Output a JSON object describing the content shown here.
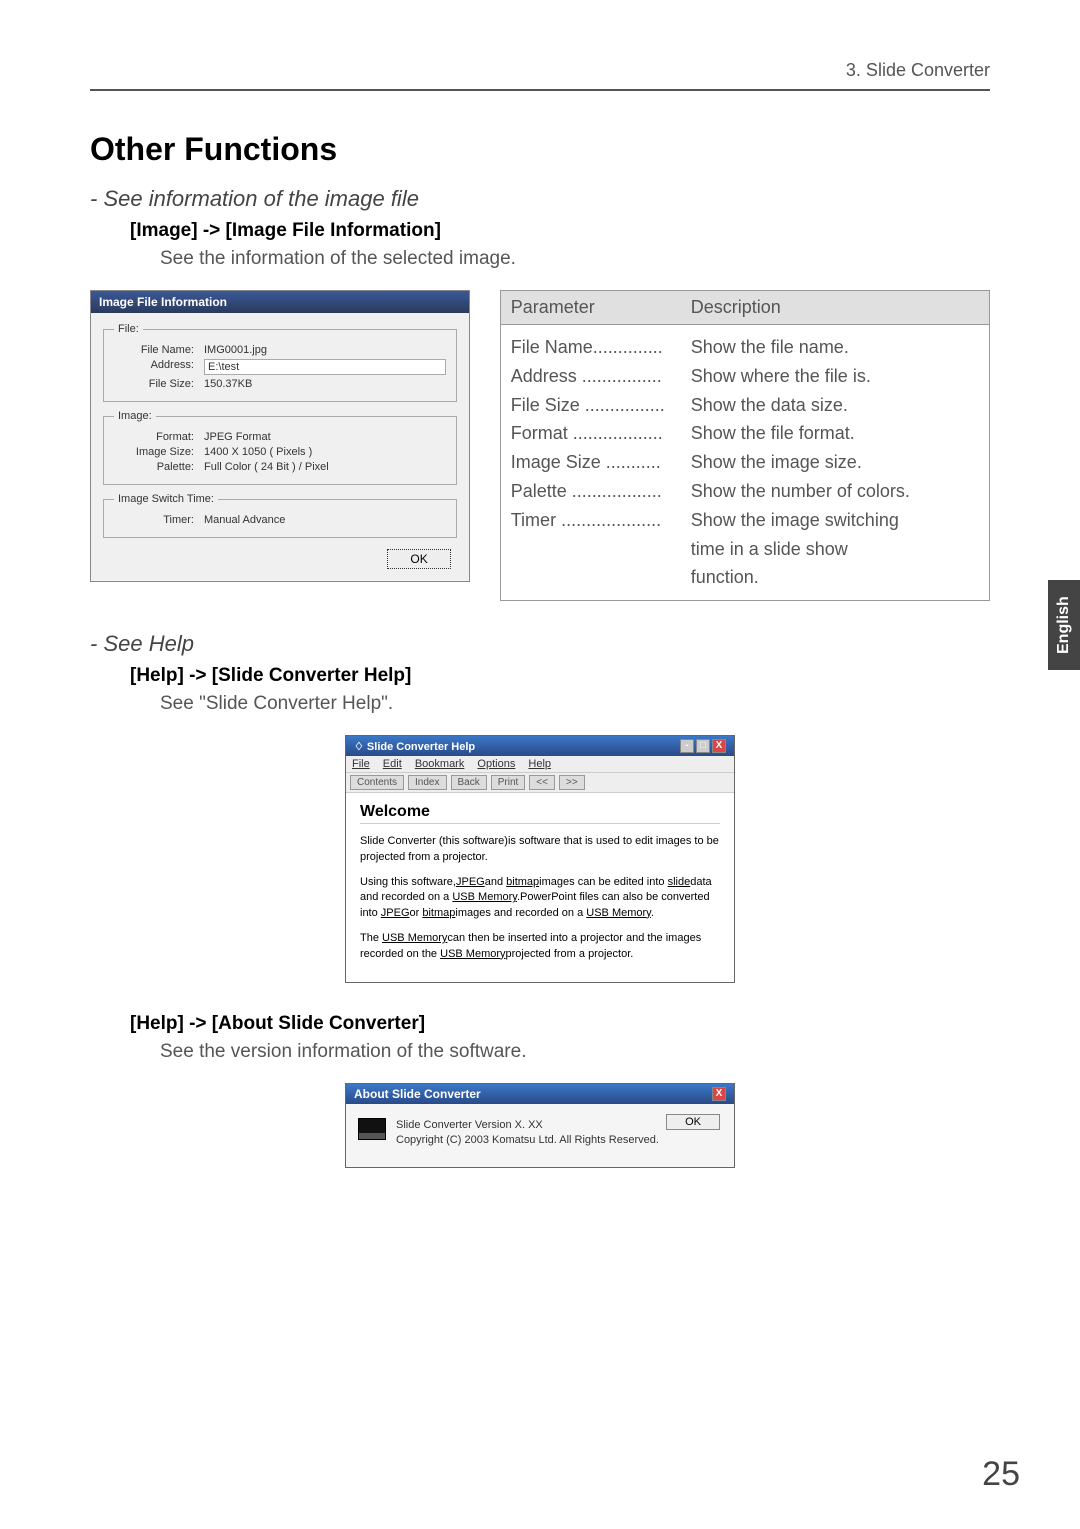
{
  "header": {
    "breadcrumb": "3. Slide Converter"
  },
  "main_heading": "Other Functions",
  "section1": {
    "subtitle": "- See information of the image file",
    "menupath": "[Image] -> [Image File Information]",
    "desc": "See the information of the selected image."
  },
  "dialog": {
    "title": "Image File Information",
    "file_legend": "File:",
    "image_legend": "Image:",
    "timer_legend": "Image Switch Time:",
    "filename_label": "File Name:",
    "filename_value": "IMG0001.jpg",
    "address_label": "Address:",
    "address_value": "E:\\test",
    "filesize_label": "File Size:",
    "filesize_value": "150.37KB",
    "format_label": "Format:",
    "format_value": "JPEG Format",
    "imagesize_label": "Image Size:",
    "imagesize_value": "1400 X 1050 ( Pixels )",
    "palette_label": "Palette:",
    "palette_value": "Full Color ( 24 Bit ) / Pixel",
    "timer_label": "Timer:",
    "timer_value": "Manual Advance",
    "ok": "OK"
  },
  "param_table": {
    "col1": "Parameter",
    "col2": "Description",
    "rows": [
      {
        "name": "File Name",
        "dots": "..............",
        "desc": "Show the file name."
      },
      {
        "name": "Address",
        "dots": " ................",
        "desc": "Show where the file is."
      },
      {
        "name": "File Size",
        "dots": " ................",
        "desc": "Show the data size."
      },
      {
        "name": "Format",
        "dots": " ..................",
        "desc": "Show the file format."
      },
      {
        "name": "Image Size",
        "dots": " ...........",
        "desc": "Show the image size."
      },
      {
        "name": "Palette",
        "dots": " ..................",
        "desc": "Show the number of colors."
      },
      {
        "name": "Timer",
        "dots": " ....................",
        "desc": "Show the image switching"
      }
    ],
    "timer_cont1": "time in a slide show",
    "timer_cont2": "function."
  },
  "side_tab": "English",
  "section2": {
    "subtitle": "- See Help",
    "menupath": "[Help] -> [Slide Converter Help]",
    "desc": "See \"Slide Converter Help\"."
  },
  "help_window": {
    "title": "Slide Converter Help",
    "menu": {
      "file": "File",
      "edit": "Edit",
      "bookmark": "Bookmark",
      "options": "Options",
      "help": "Help"
    },
    "toolbar": {
      "contents": "Contents",
      "index": "Index",
      "back": "Back",
      "print": "Print",
      "prev": "<<",
      "next": ">>"
    },
    "welcome": "Welcome",
    "p1a": "Slide Converter (this software)is software that is used to edit images to be projected from a projector.",
    "p2a": "Using this software,",
    "p2b": "JPEG",
    "p2c": "and ",
    "p2d": "bitmap",
    "p2e": "images can be edited into ",
    "p2f": "slide",
    "p2g": "data and recorded on a ",
    "p2h": "USB Memory",
    "p2i": ".PowerPoint files can also be converted into ",
    "p2j": "JPEG",
    "p2k": "or ",
    "p2l": "bitmap",
    "p2m": "images and recorded on a ",
    "p2n": "USB Memory",
    "p2o": ".",
    "p3a": "The ",
    "p3b": "USB Memory",
    "p3c": "can then be inserted into a projector and the images recorded on the ",
    "p3d": "USB Memory",
    "p3e": "projected from a projector."
  },
  "section3": {
    "menupath": "[Help] -> [About Slide Converter]",
    "desc": "See the version information of the software."
  },
  "about_window": {
    "title": "About Slide Converter",
    "line1": "Slide Converter Version X. XX",
    "line2": "Copyright (C) 2003 Komatsu Ltd. All Rights Reserved.",
    "ok": "OK",
    "close": "X"
  },
  "page_number": "25"
}
